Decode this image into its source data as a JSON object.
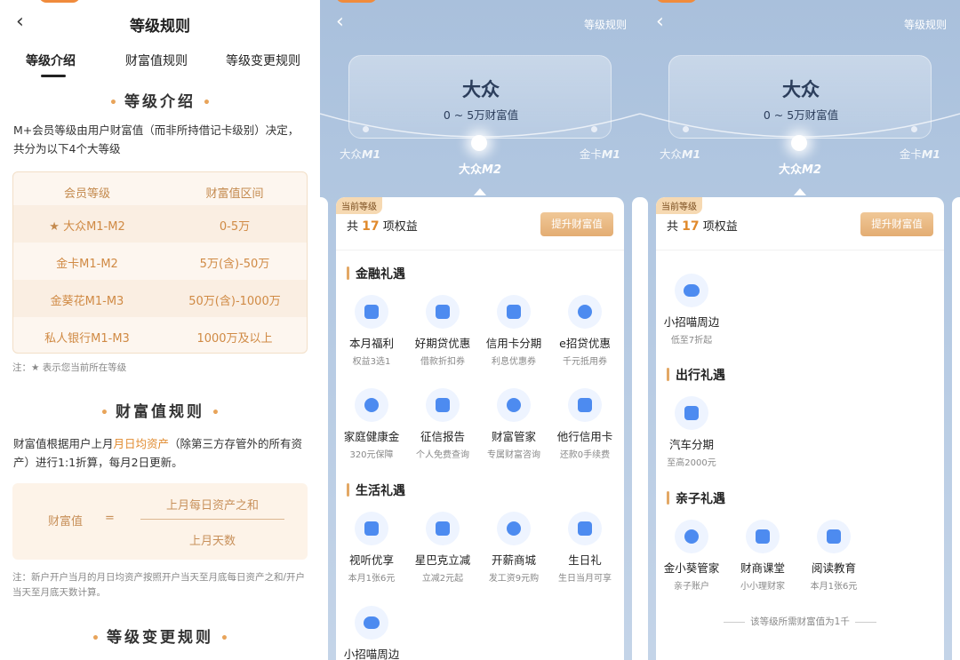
{
  "left": {
    "title": "等级规则",
    "tabs": [
      "等级介绍",
      "财富值规则",
      "等级变更规则"
    ],
    "sec1": "等级介绍",
    "intro": "M+会员等级由用户财富值（而非所持借记卡级别）决定，共分为以下4个大等级",
    "table": {
      "headers": [
        "会员等级",
        "财富值区间"
      ],
      "rows": [
        [
          "大众M1-M2",
          "0-5万"
        ],
        [
          "金卡M1-M2",
          "5万(含)-50万"
        ],
        [
          "金葵花M1-M3",
          "50万(含)-1000万"
        ],
        [
          "私人银行M1-M3",
          "1000万及以上"
        ]
      ],
      "star": "★"
    },
    "note1": "注：★ 表示您当前所在等级",
    "sec2": "财富值规则",
    "rule_a": "财富值根据用户上月",
    "rule_hl": "月日均资产",
    "rule_b": "（除第三方存管外的所有资产）进行1:1折算，每月2日更新。",
    "formula": {
      "label": "财富值",
      "eq": "=",
      "num": "上月每日资产之和",
      "den": "上月天数"
    },
    "note2": "注：新户开户当月的月日均资产按照开户当天至月底每日资产之和/开户当天至月底天数计算。",
    "sec3": "等级变更规则"
  },
  "phone": {
    "rule_link": "等级规则",
    "level": "大众",
    "range": "0 ~ 5万财富值",
    "m_left": "大众",
    "m_left_i": "M1",
    "m_center": "大众",
    "m_center_i": "M2",
    "m_right": "金卡",
    "m_right_i": "M1",
    "badge": "当前等级",
    "count_a": "共",
    "count_n": "17",
    "count_b": "项权益",
    "upgrade": "提升财富值"
  },
  "p2": {
    "cat1": "金融礼遇",
    "fin": [
      {
        "name": "本月福利",
        "sub": "权益3选1"
      },
      {
        "name": "好期贷优惠",
        "sub": "借款折扣券"
      },
      {
        "name": "信用卡分期",
        "sub": "利息优惠券"
      },
      {
        "name": "e招贷优惠",
        "sub": "千元抵用券"
      },
      {
        "name": "家庭健康金",
        "sub": "320元保障"
      },
      {
        "name": "征信报告",
        "sub": "个人免费查询"
      },
      {
        "name": "财富管家",
        "sub": "专属财富咨询"
      },
      {
        "name": "他行信用卡",
        "sub": "还款0手续费"
      }
    ],
    "cat2": "生活礼遇",
    "life": [
      {
        "name": "视听优享",
        "sub": "本月1张6元"
      },
      {
        "name": "星巴克立减",
        "sub": "立减2元起"
      },
      {
        "name": "开薪商城",
        "sub": "发工资9元购"
      },
      {
        "name": "生日礼",
        "sub": "生日当月可享"
      },
      {
        "name": "小招喵周边",
        "sub": ""
      }
    ]
  },
  "p3": {
    "top_item": {
      "name": "小招喵周边",
      "sub": "低至7折起"
    },
    "cat1": "出行礼遇",
    "travel": {
      "name": "汽车分期",
      "sub": "至高2000元"
    },
    "cat2": "亲子礼遇",
    "kids": [
      {
        "name": "金小葵管家",
        "sub": "亲子账户"
      },
      {
        "name": "财商课堂",
        "sub": "小小理财家"
      },
      {
        "name": "阅读教育",
        "sub": "本月1张6元"
      }
    ],
    "foot": "该等级所需财富值为1千"
  },
  "colors": {
    "accent": "#e0892b",
    "blue_icon": "#4d8bf0",
    "gold": "#e3ad73"
  }
}
